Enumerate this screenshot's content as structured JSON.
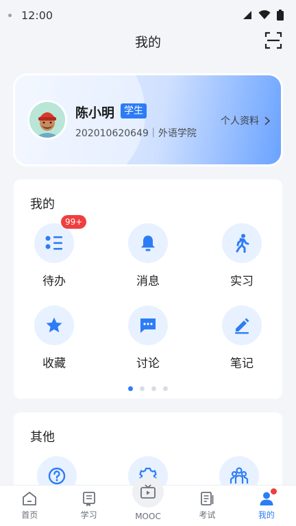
{
  "status": {
    "time": "12:00"
  },
  "nav": {
    "title": "我的",
    "scan_icon": "scan-icon"
  },
  "profile": {
    "name": "陈小明",
    "role": "学生",
    "id_line": "202010620649｜外语学院",
    "link": "个人资料"
  },
  "mine": {
    "title": "我的",
    "items": [
      {
        "label": "待办",
        "icon": "todo-icon",
        "badge": "99+"
      },
      {
        "label": "消息",
        "icon": "bell-icon"
      },
      {
        "label": "实习",
        "icon": "walk-icon"
      },
      {
        "label": "收藏",
        "icon": "star-icon"
      },
      {
        "label": "讨论",
        "icon": "chat-icon"
      },
      {
        "label": "笔记",
        "icon": "edit-icon"
      }
    ],
    "pager": {
      "count": 4,
      "active": 0
    }
  },
  "other": {
    "title": "其他",
    "items": [
      {
        "icon": "help-icon"
      },
      {
        "icon": "settings-icon"
      },
      {
        "icon": "group-icon"
      }
    ]
  },
  "tabbar": {
    "items": [
      {
        "label": "首页",
        "icon": "home-icon"
      },
      {
        "label": "学习",
        "icon": "book-icon"
      },
      {
        "label": "MOOC",
        "icon": "tv-icon"
      },
      {
        "label": "考试",
        "icon": "exam-icon"
      },
      {
        "label": "我的",
        "icon": "user-icon",
        "active": true
      }
    ]
  },
  "colors": {
    "accent": "#2d7cf6",
    "badge": "#ef3e3e",
    "icon_bg": "#e8f1ff"
  }
}
